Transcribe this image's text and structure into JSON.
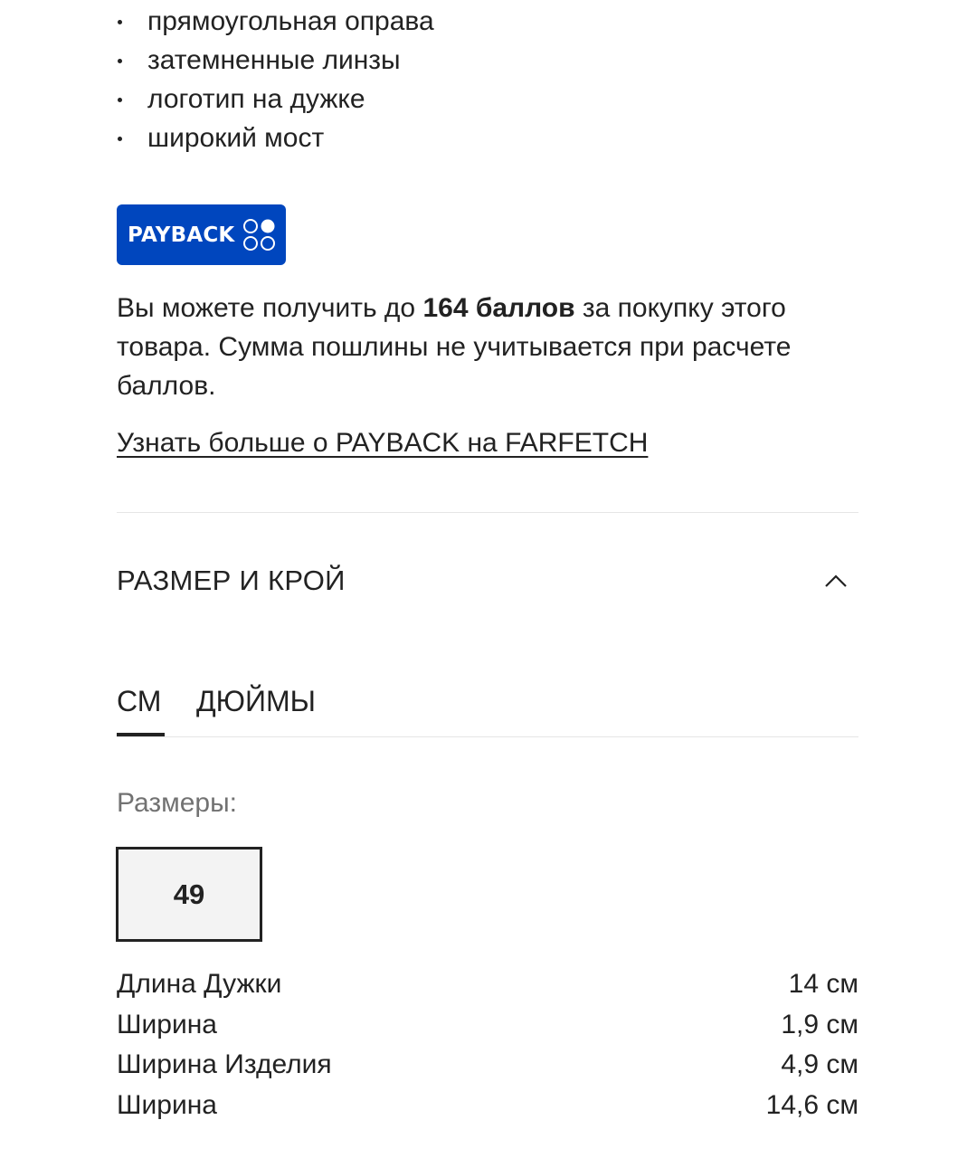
{
  "details": {
    "bullets": [
      "прямоугольная оправа",
      "затемненные линзы",
      "логотип на дужке",
      "широкий мост"
    ]
  },
  "payback": {
    "logo_text": "PAYBACK",
    "brand_color": "#0046be",
    "desc_before": "Вы можете получить до ",
    "desc_bold": "164 баллов",
    "desc_after": " за покупку этого товара. Сумма пошлины не учитывается при расчете баллов.",
    "link_label": "Узнать больше о PAYBACK на FARFETCH"
  },
  "size_fit": {
    "title": "РАЗМЕР И КРОЙ",
    "toggle_icon": "chevron-up-icon",
    "tabs": [
      {
        "label": "СМ",
        "active": true
      },
      {
        "label": "ДЮЙМЫ",
        "active": false
      }
    ],
    "sizes_label": "Размеры:",
    "sizes": [
      "49"
    ],
    "selected_size": "49",
    "measurements": [
      {
        "label": "Длина Дужки",
        "value": "14 см"
      },
      {
        "label": "Ширина",
        "value": "1,9 см"
      },
      {
        "label": "Ширина Изделия",
        "value": "4,9 см"
      },
      {
        "label": "Ширина",
        "value": "14,6 см"
      }
    ]
  }
}
